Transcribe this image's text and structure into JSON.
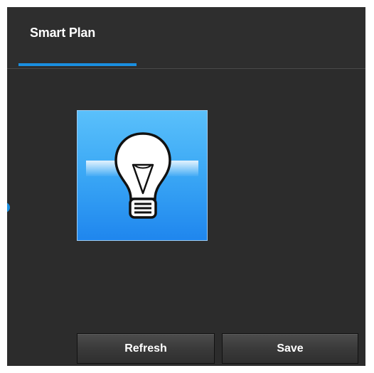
{
  "tabs": [
    {
      "label": "Smart Plan",
      "active": true
    }
  ],
  "plans": [
    {
      "icon": "lightbulb-icon",
      "color": "#3ba8f5"
    }
  ],
  "actions": {
    "refresh_label": "Refresh",
    "save_label": "Save"
  },
  "colors": {
    "accent": "#1a8fe0",
    "panel_bg": "#2c2c2c"
  }
}
